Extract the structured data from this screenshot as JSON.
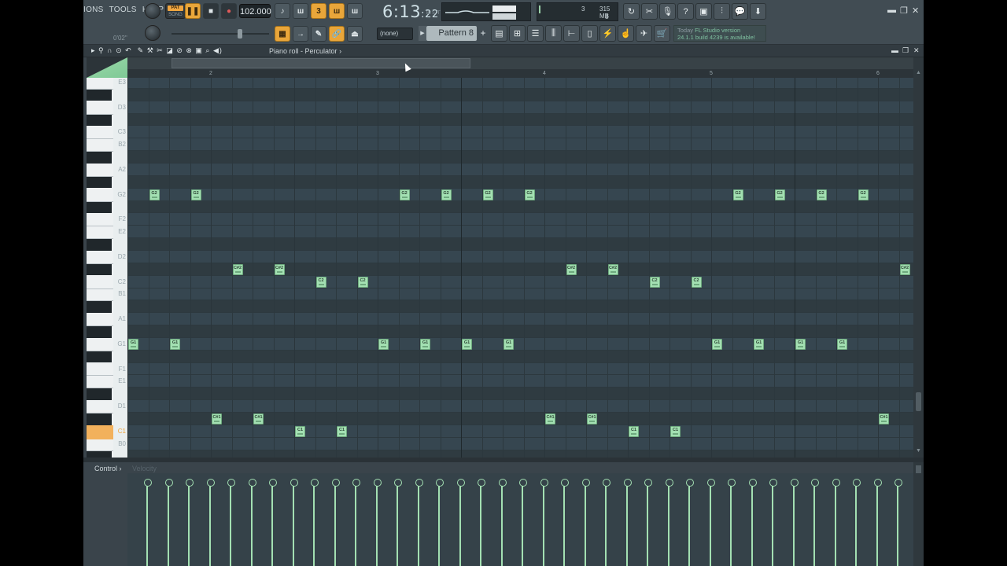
{
  "menu": [
    "IONS",
    "TOOLS",
    "HELP"
  ],
  "transport": {
    "pat_label": "PAT",
    "song_label": "SONG",
    "tempo": "102.000",
    "time_main": "6:13",
    "time_sub": "22",
    "time_marker": "B:S:T",
    "hint_time": "0'02\""
  },
  "cpu": {
    "voices": "3",
    "memory": "315 MB",
    "cpu_count": "8"
  },
  "snap": "(none)",
  "pattern": "Pattern 8",
  "hint": {
    "today": "Today",
    "line1": "FL Studio version",
    "line2": "24.1.1 build 4239 is available!"
  },
  "piano_roll": {
    "title": "Piano roll - Perculator",
    "title_arrow": "›",
    "bar_numbers": [
      "2",
      "3",
      "4",
      "5",
      "6"
    ],
    "key_labels": [
      "E3",
      "D3",
      "C3",
      "B2",
      "A2",
      "G2",
      "F2",
      "E2",
      "D2",
      "C2",
      "B1",
      "A1",
      "G1",
      "F1",
      "E1",
      "D1",
      "C1",
      "B0"
    ],
    "notes": [
      {
        "label": "G2",
        "step": 1,
        "key": "G2"
      },
      {
        "label": "G2",
        "step": 3,
        "key": "G2"
      },
      {
        "label": "G2",
        "step": 13,
        "key": "G2"
      },
      {
        "label": "G2",
        "step": 15,
        "key": "G2"
      },
      {
        "label": "G2",
        "step": 17,
        "key": "G2"
      },
      {
        "label": "G2",
        "step": 19,
        "key": "G2"
      },
      {
        "label": "G2",
        "step": 29,
        "key": "G2"
      },
      {
        "label": "G2",
        "step": 31,
        "key": "G2"
      },
      {
        "label": "G2",
        "step": 33,
        "key": "G2"
      },
      {
        "label": "G2",
        "step": 35,
        "key": "G2"
      },
      {
        "label": "C#2",
        "step": 5,
        "key": "C#2"
      },
      {
        "label": "C#2",
        "step": 7,
        "key": "C#2"
      },
      {
        "label": "C2",
        "step": 9,
        "key": "C2"
      },
      {
        "label": "C2",
        "step": 11,
        "key": "C2"
      },
      {
        "label": "C#2",
        "step": 21,
        "key": "C#2"
      },
      {
        "label": "C#2",
        "step": 23,
        "key": "C#2"
      },
      {
        "label": "C2",
        "step": 25,
        "key": "C2"
      },
      {
        "label": "C2",
        "step": 27,
        "key": "C2"
      },
      {
        "label": "C#2",
        "step": 37,
        "key": "C#2"
      },
      {
        "label": "G1",
        "step": 0,
        "key": "G1"
      },
      {
        "label": "G1",
        "step": 2,
        "key": "G1"
      },
      {
        "label": "G1",
        "step": 12,
        "key": "G1"
      },
      {
        "label": "G1",
        "step": 14,
        "key": "G1"
      },
      {
        "label": "G1",
        "step": 16,
        "key": "G1"
      },
      {
        "label": "G1",
        "step": 18,
        "key": "G1"
      },
      {
        "label": "G1",
        "step": 28,
        "key": "G1"
      },
      {
        "label": "G1",
        "step": 30,
        "key": "G1"
      },
      {
        "label": "G1",
        "step": 32,
        "key": "G1"
      },
      {
        "label": "G1",
        "step": 34,
        "key": "G1"
      },
      {
        "label": "C#1",
        "step": 4,
        "key": "C#1"
      },
      {
        "label": "C#1",
        "step": 6,
        "key": "C#1"
      },
      {
        "label": "C1",
        "step": 8,
        "key": "C1"
      },
      {
        "label": "C1",
        "step": 10,
        "key": "C1"
      },
      {
        "label": "C#1",
        "step": 20,
        "key": "C#1"
      },
      {
        "label": "C#1",
        "step": 22,
        "key": "C#1"
      },
      {
        "label": "C1",
        "step": 24,
        "key": "C1"
      },
      {
        "label": "C1",
        "step": 26,
        "key": "C1"
      },
      {
        "label": "C#1",
        "step": 36,
        "key": "C#1"
      }
    ]
  },
  "control": {
    "label": "Control",
    "label_arrow": "›",
    "param": "Velocity",
    "velocity_count": 37
  },
  "colors": {
    "note": "#a3e0b2",
    "accent": "#e9a63a",
    "c1_key": "#f2b15c"
  },
  "icons": [
    "record-icon",
    "play-icon",
    "stop-icon",
    "metronome-icon",
    "undo-icon",
    "save-icon",
    "help-icon",
    "mic-icon",
    "close-icon",
    "minimize-icon",
    "maximize-icon"
  ]
}
